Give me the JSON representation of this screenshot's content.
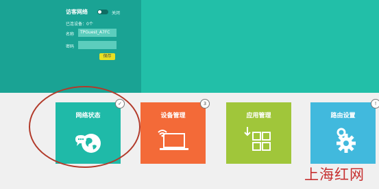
{
  "guest_panel": {
    "title": "访客网络",
    "toggle_label": "关闭",
    "devices_text": "已连设备：0个",
    "ssid_label": "名称",
    "ssid_value": "TPGuest_A7FC",
    "password_label": "密码",
    "password_value": "",
    "save_label": "保存"
  },
  "tiles": [
    {
      "title": "网络状态",
      "badge": "✓",
      "color": "#1fbaa8",
      "icon": "globe-icon"
    },
    {
      "title": "设备管理",
      "badge": "3",
      "color": "#f36a38",
      "icon": "laptop-icon"
    },
    {
      "title": "应用管理",
      "badge": "",
      "color": "#a0c63a",
      "icon": "apps-grid-icon"
    },
    {
      "title": "路由设置",
      "badge": "!",
      "color": "#41b9dd",
      "icon": "gear-icon"
    }
  ],
  "watermark": "上海红网"
}
